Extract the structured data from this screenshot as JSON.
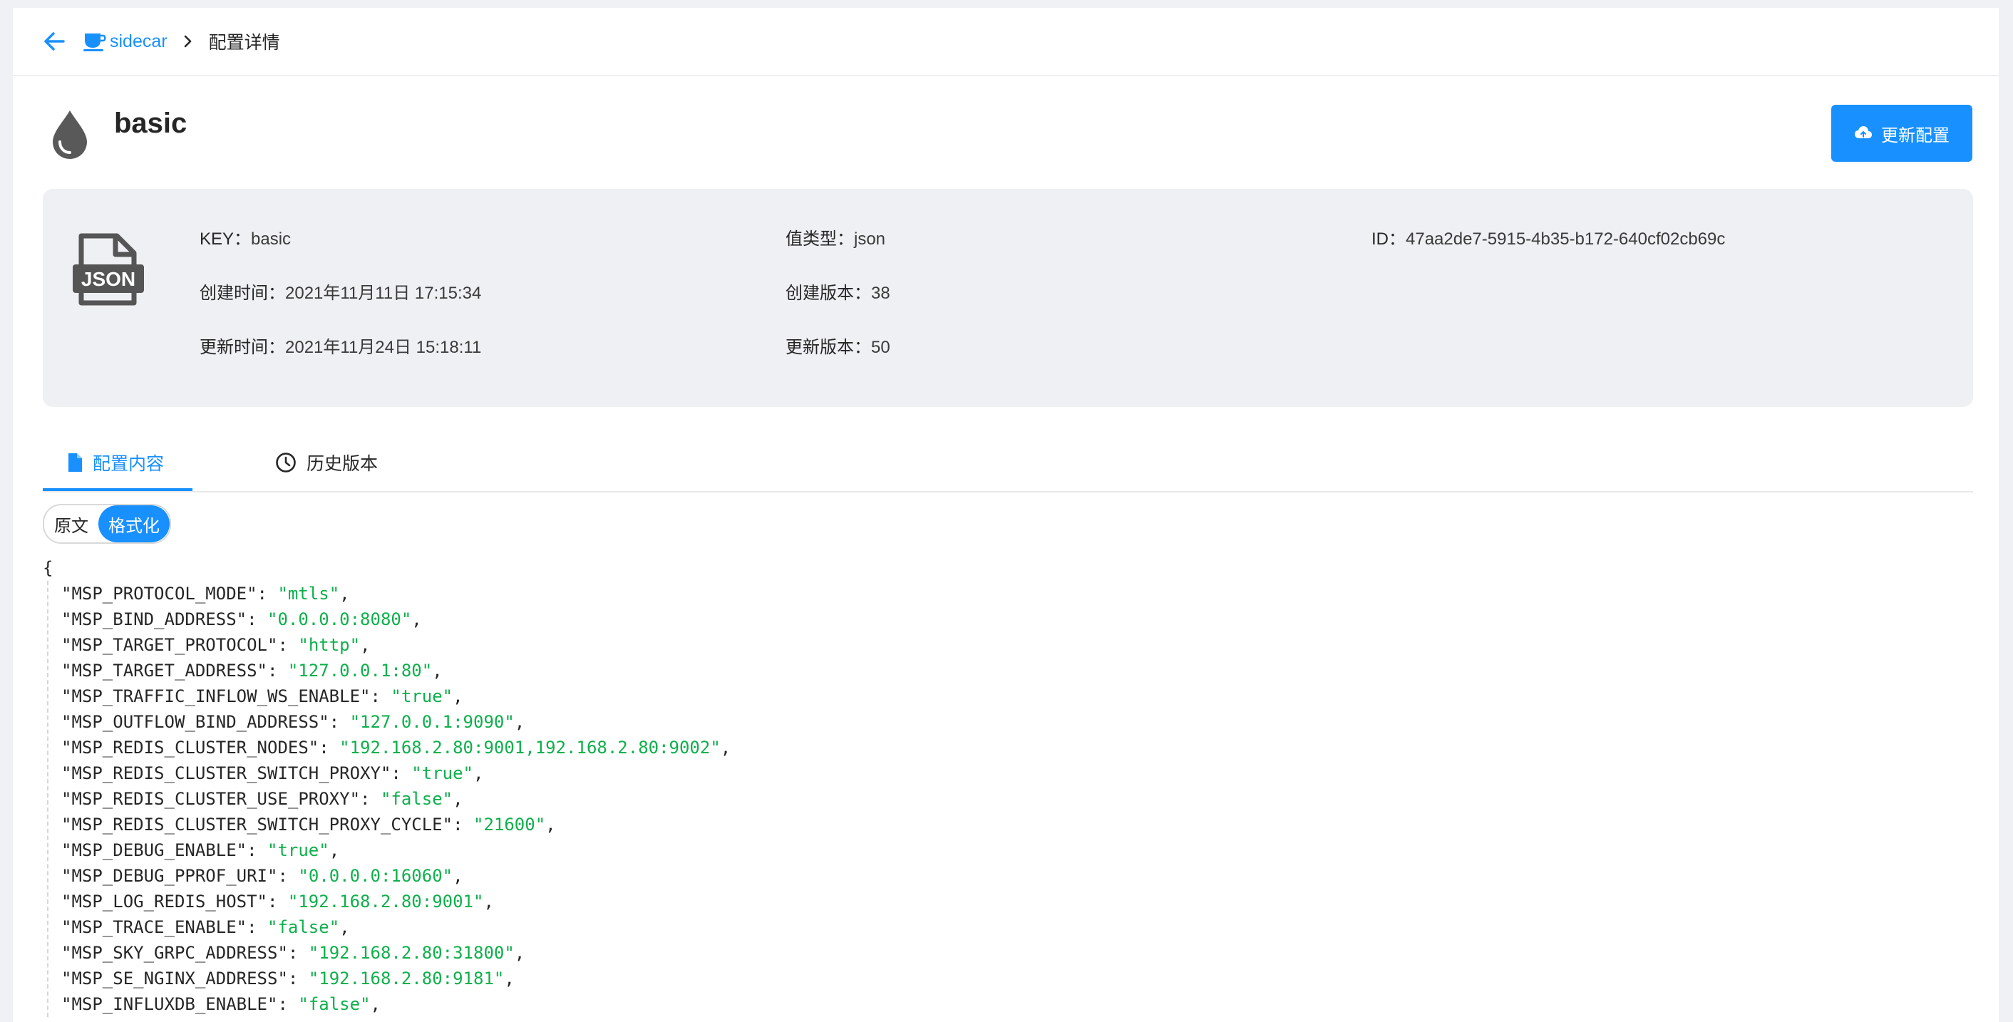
{
  "breadcrumb": {
    "app": "sidecar",
    "current": "配置详情"
  },
  "config": {
    "title": "basic",
    "update_label": "更新配置"
  },
  "info": {
    "key_label": "KEY：",
    "key": "basic",
    "type_label": "值类型：",
    "type": "json",
    "id_label": "ID：",
    "id": "47aa2de7-5915-4b35-b172-640cf02cb69c",
    "created_label": "创建时间：",
    "created": "2021年11月11日 17:15:34",
    "created_ver_label": "创建版本：",
    "created_ver": "38",
    "updated_label": "更新时间：",
    "updated": "2021年11月24日 15:18:11",
    "updated_ver_label": "更新版本：",
    "updated_ver": "50",
    "icon_text": "JSON"
  },
  "tabs": [
    {
      "label": "配置内容",
      "icon": "file-icon",
      "active": true
    },
    {
      "label": "历史版本",
      "icon": "clock-icon",
      "active": false
    }
  ],
  "view_toggle": {
    "raw": "原文",
    "formatted": "格式化",
    "selected": "格式化"
  },
  "code": {
    "open": "{",
    "entries": [
      {
        "key": "MSP_PROTOCOL_MODE",
        "value": "mtls"
      },
      {
        "key": "MSP_BIND_ADDRESS",
        "value": "0.0.0.0:8080"
      },
      {
        "key": "MSP_TARGET_PROTOCOL",
        "value": "http"
      },
      {
        "key": "MSP_TARGET_ADDRESS",
        "value": "127.0.0.1:80"
      },
      {
        "key": "MSP_TRAFFIC_INFLOW_WS_ENABLE",
        "value": "true"
      },
      {
        "key": "MSP_OUTFLOW_BIND_ADDRESS",
        "value": "127.0.0.1:9090"
      },
      {
        "key": "MSP_REDIS_CLUSTER_NODES",
        "value": "192.168.2.80:9001,192.168.2.80:9002"
      },
      {
        "key": "MSP_REDIS_CLUSTER_SWITCH_PROXY",
        "value": "true"
      },
      {
        "key": "MSP_REDIS_CLUSTER_USE_PROXY",
        "value": "false"
      },
      {
        "key": "MSP_REDIS_CLUSTER_SWITCH_PROXY_CYCLE",
        "value": "21600"
      },
      {
        "key": "MSP_DEBUG_ENABLE",
        "value": "true"
      },
      {
        "key": "MSP_DEBUG_PPROF_URI",
        "value": "0.0.0.0:16060"
      },
      {
        "key": "MSP_LOG_REDIS_HOST",
        "value": "192.168.2.80:9001"
      },
      {
        "key": "MSP_TRACE_ENABLE",
        "value": "false"
      },
      {
        "key": "MSP_SKY_GRPC_ADDRESS",
        "value": "192.168.2.80:31800"
      },
      {
        "key": "MSP_SE_NGINX_ADDRESS",
        "value": "192.168.2.80:9181"
      },
      {
        "key": "MSP_INFLUXDB_ENABLE",
        "value": "false"
      }
    ]
  }
}
